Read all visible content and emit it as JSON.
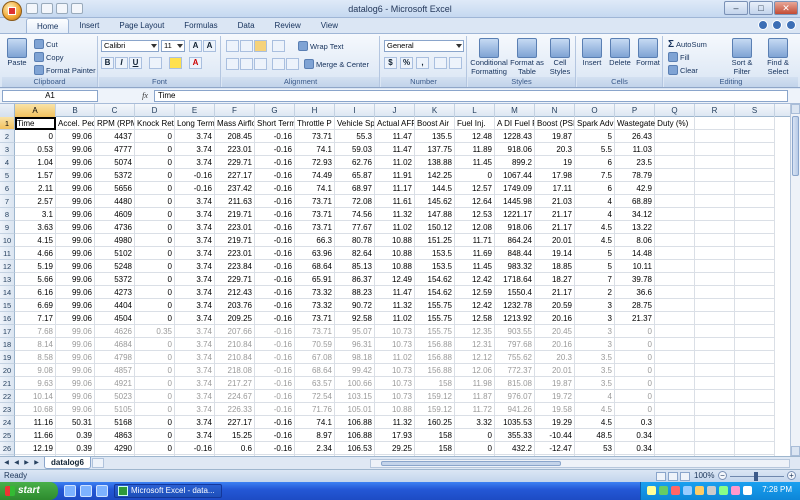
{
  "window": {
    "title": "datalog6 - Microsoft Excel",
    "minimize": "–",
    "maximize": "□",
    "close": "✕"
  },
  "ribbon_tabs": [
    "Home",
    "Insert",
    "Page Layout",
    "Formulas",
    "Data",
    "Review",
    "View"
  ],
  "ribbon": {
    "clipboard": {
      "label": "Clipboard",
      "paste": "Paste",
      "cut": "Cut",
      "copy": "Copy",
      "format_painter": "Format Painter"
    },
    "font": {
      "label": "Font",
      "name": "Calibri",
      "size": "11",
      "bold": "B",
      "italic": "I",
      "underline": "U"
    },
    "alignment": {
      "label": "Alignment",
      "wrap_text": "Wrap Text",
      "merge_center": "Merge & Center"
    },
    "number": {
      "label": "Number",
      "format": "General",
      "currency": "$",
      "percent": "%",
      "comma": ","
    },
    "styles": {
      "label": "Styles",
      "conditional": "Conditional Formatting",
      "format_table": "Format as Table",
      "cell_styles": "Cell Styles"
    },
    "cells": {
      "label": "Cells",
      "insert": "Insert",
      "delete": "Delete",
      "format": "Format"
    },
    "editing": {
      "label": "Editing",
      "autosum": "AutoSum",
      "fill": "Fill",
      "clear": "Clear",
      "sort_filter": "Sort & Filter",
      "find_select": "Find & Select"
    }
  },
  "formula_bar": {
    "name_box": "A1",
    "fx": "fx",
    "content": "Time"
  },
  "columns": [
    "A",
    "B",
    "C",
    "D",
    "E",
    "F",
    "G",
    "H",
    "I",
    "J",
    "K",
    "L",
    "M",
    "N",
    "O",
    "P",
    "Q",
    "R",
    "S"
  ],
  "headers": [
    "Time",
    "Accel. Pedal",
    "RPM (RPM)",
    "Knock Ret",
    "Long Term",
    "Mass Airflow",
    "Short Term",
    "Throttle P",
    "Vehicle Sp",
    "Actual AFR",
    "Boost Air",
    "Fuel Inj.",
    "A DI Fuel Pr",
    "Boost (PSI)",
    "Spark Adv",
    "Wastegate Duty (%)",
    "",
    "",
    ""
  ],
  "rows": [
    [
      "0",
      "99.06",
      "4437",
      "0",
      "3.74",
      "208.45",
      "-0.16",
      "73.71",
      "55.3",
      "11.47",
      "135.5",
      "12.48",
      "1228.43",
      "19.87",
      "5",
      "26.43"
    ],
    [
      "0.53",
      "99.06",
      "4777",
      "0",
      "3.74",
      "223.01",
      "-0.16",
      "74.1",
      "59.03",
      "11.47",
      "137.75",
      "11.89",
      "918.06",
      "20.3",
      "5.5",
      "11.03"
    ],
    [
      "1.04",
      "99.06",
      "5074",
      "0",
      "3.74",
      "229.71",
      "-0.16",
      "72.93",
      "62.76",
      "11.02",
      "138.88",
      "11.45",
      "899.2",
      "19",
      "6",
      "23.5"
    ],
    [
      "1.57",
      "99.06",
      "5372",
      "0",
      "-0.16",
      "227.17",
      "-0.16",
      "74.49",
      "65.87",
      "11.91",
      "142.25",
      "0",
      "1067.44",
      "17.98",
      "7.5",
      "78.79"
    ],
    [
      "2.11",
      "99.06",
      "5656",
      "0",
      "-0.16",
      "237.42",
      "-0.16",
      "74.1",
      "68.97",
      "11.17",
      "144.5",
      "12.57",
      "1749.09",
      "17.11",
      "6",
      "42.9"
    ],
    [
      "2.57",
      "99.06",
      "4480",
      "0",
      "3.74",
      "211.63",
      "-0.16",
      "73.71",
      "72.08",
      "11.61",
      "145.62",
      "12.64",
      "1445.98",
      "21.03",
      "4",
      "68.89"
    ],
    [
      "3.1",
      "99.06",
      "4609",
      "0",
      "3.74",
      "219.71",
      "-0.16",
      "73.71",
      "74.56",
      "11.32",
      "147.88",
      "12.53",
      "1221.17",
      "21.17",
      "4",
      "34.12"
    ],
    [
      "3.63",
      "99.06",
      "4736",
      "0",
      "3.74",
      "223.01",
      "-0.16",
      "73.71",
      "77.67",
      "11.02",
      "150.12",
      "12.08",
      "918.06",
      "21.17",
      "4.5",
      "13.22"
    ],
    [
      "4.15",
      "99.06",
      "4980",
      "0",
      "3.74",
      "219.71",
      "-0.16",
      "66.3",
      "80.78",
      "10.88",
      "151.25",
      "11.71",
      "864.24",
      "20.01",
      "4.5",
      "8.06"
    ],
    [
      "4.66",
      "99.06",
      "5102",
      "0",
      "3.74",
      "223.01",
      "-0.16",
      "63.96",
      "82.64",
      "10.88",
      "153.5",
      "11.69",
      "848.44",
      "19.14",
      "5",
      "14.48"
    ],
    [
      "5.19",
      "99.06",
      "5248",
      "0",
      "3.74",
      "223.84",
      "-0.16",
      "68.64",
      "85.13",
      "10.88",
      "153.5",
      "11.45",
      "983.32",
      "18.85",
      "5",
      "10.11"
    ],
    [
      "5.66",
      "99.06",
      "5372",
      "0",
      "3.74",
      "229.71",
      "-0.16",
      "65.91",
      "86.37",
      "12.49",
      "154.62",
      "12.42",
      "1718.64",
      "18.27",
      "7",
      "39.78"
    ],
    [
      "6.16",
      "99.06",
      "4273",
      "0",
      "3.74",
      "212.43",
      "-0.16",
      "73.32",
      "88.23",
      "11.47",
      "154.62",
      "12.59",
      "1550.4",
      "21.17",
      "2",
      "36.6"
    ],
    [
      "6.69",
      "99.06",
      "4404",
      "0",
      "3.74",
      "203.76",
      "-0.16",
      "73.32",
      "90.72",
      "11.32",
      "155.75",
      "12.42",
      "1232.78",
      "20.59",
      "3",
      "28.75"
    ],
    [
      "7.17",
      "99.06",
      "4504",
      "0",
      "3.74",
      "209.25",
      "-0.16",
      "73.71",
      "92.58",
      "11.02",
      "155.75",
      "12.58",
      "1213.92",
      "20.16",
      "3",
      "21.37"
    ],
    [
      "7.68",
      "99.06",
      "4626",
      "0.35",
      "3.74",
      "207.66",
      "-0.16",
      "73.71",
      "95.07",
      "10.73",
      "155.75",
      "12.35",
      "903.55",
      "20.45",
      "3",
      "0"
    ],
    [
      "8.14",
      "99.06",
      "4684",
      "0",
      "3.74",
      "210.84",
      "-0.16",
      "70.59",
      "96.31",
      "10.73",
      "156.88",
      "12.31",
      "797.68",
      "20.16",
      "3",
      "0"
    ],
    [
      "8.58",
      "99.06",
      "4798",
      "0",
      "3.74",
      "210.84",
      "-0.16",
      "67.08",
      "98.18",
      "11.02",
      "156.88",
      "12.12",
      "755.62",
      "20.3",
      "3.5",
      "0"
    ],
    [
      "9.08",
      "99.06",
      "4857",
      "0",
      "3.74",
      "218.08",
      "-0.16",
      "68.64",
      "99.42",
      "10.73",
      "156.88",
      "12.06",
      "772.37",
      "20.01",
      "3.5",
      "0"
    ],
    [
      "9.63",
      "99.06",
      "4921",
      "0",
      "3.74",
      "217.27",
      "-0.16",
      "63.57",
      "100.66",
      "10.73",
      "158",
      "11.98",
      "815.08",
      "19.87",
      "3.5",
      "0"
    ],
    [
      "10.14",
      "99.06",
      "5023",
      "0",
      "3.74",
      "224.67",
      "-0.16",
      "72.54",
      "103.15",
      "10.73",
      "159.12",
      "11.87",
      "976.07",
      "19.72",
      "4",
      "0"
    ],
    [
      "10.68",
      "99.06",
      "5105",
      "0",
      "3.74",
      "226.33",
      "-0.16",
      "71.76",
      "105.01",
      "10.88",
      "159.12",
      "11.72",
      "941.26",
      "19.58",
      "4.5",
      "0"
    ],
    [
      "11.16",
      "50.31",
      "5168",
      "0",
      "3.74",
      "227.17",
      "-0.16",
      "74.1",
      "106.88",
      "11.32",
      "160.25",
      "3.32",
      "1035.53",
      "19.29",
      "4.5",
      "0.3"
    ],
    [
      "11.66",
      "0.39",
      "4863",
      "0",
      "3.74",
      "15.25",
      "-0.16",
      "8.97",
      "106.88",
      "17.93",
      "158",
      "0",
      "355.33",
      "-10.44",
      "48.5",
      "0.34"
    ],
    [
      "12.19",
      "0.39",
      "4290",
      "0",
      "-0.16",
      "0.6",
      "-0.16",
      "2.34",
      "106.53",
      "29.25",
      "158",
      "0",
      "432.2",
      "-12.47",
      "53",
      "0.34"
    ],
    [
      "",
      "",
      "",
      "",
      "",
      "",
      "",
      "",
      "",
      "",
      "",
      "",
      "",
      "",
      "",
      ""
    ]
  ],
  "sheet_tab": "datalog6",
  "status": {
    "text": "Ready",
    "zoom": "100%",
    "minus": "−",
    "plus": "+"
  },
  "taskbar": {
    "start": "start",
    "task": "Microsoft Excel - data...",
    "clock": "7:28 PM"
  },
  "colors": {
    "ribbon": "#dbe6f4",
    "selected_header": "#f1c15f",
    "taskbar": "#2458d6",
    "start": "#2d8a2e"
  }
}
